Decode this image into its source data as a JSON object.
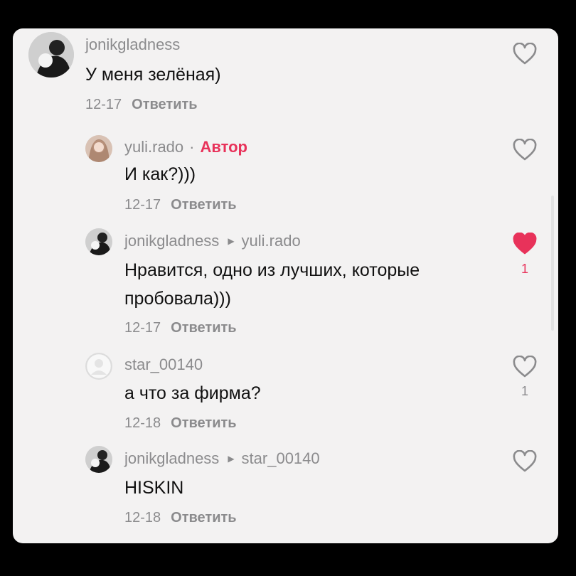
{
  "comments": [
    {
      "username": "jonikgladness",
      "text": "У меня зелёная)",
      "date": "12-17",
      "reply_label": "Ответить",
      "avatar_icon": "user-avatar-photo"
    },
    {
      "username": "yuli.rado",
      "separator": "·",
      "author_badge": "Автор",
      "text": "И как?)))",
      "date": "12-17",
      "reply_label": "Ответить",
      "avatar_icon": "user-avatar-photo"
    },
    {
      "username": "jonikgladness",
      "reply_to": "yuli.rado",
      "text": "Нравится, одно из лучших, которые пробовала)))",
      "date": "12-17",
      "reply_label": "Ответить",
      "like_count": "1",
      "liked": true,
      "avatar_icon": "user-avatar-photo"
    },
    {
      "username": "star_00140",
      "text": "а что за фирма?",
      "date": "12-18",
      "reply_label": "Ответить",
      "like_count": "1",
      "liked": false,
      "avatar_icon": "default-avatar"
    },
    {
      "username": "jonikgladness",
      "reply_to": "star_00140",
      "text": "HISKIN",
      "date": "12-18",
      "reply_label": "Ответить",
      "avatar_icon": "user-avatar-photo"
    }
  ],
  "colors": {
    "author": "#e8325a",
    "liked_heart": "#e8325a",
    "muted": "#8b8b8d",
    "card_bg": "#f3f2f2"
  }
}
